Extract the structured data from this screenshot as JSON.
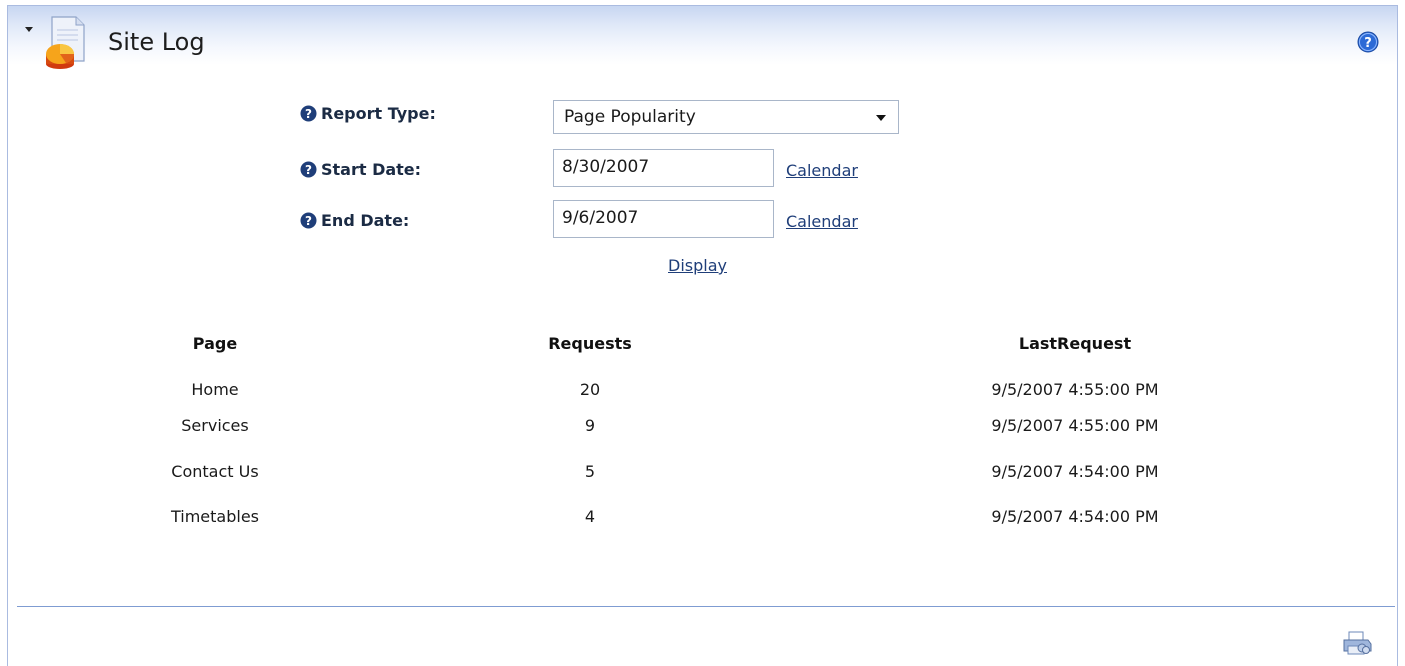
{
  "header": {
    "title": "Site Log",
    "collapse_icon": "collapse-arrow-icon",
    "module_icon": "site-log-icon",
    "help_icon": "help-icon"
  },
  "form": {
    "report_type": {
      "label": "Report Type:",
      "value": "Page Popularity"
    },
    "start_date": {
      "label": "Start Date:",
      "value": "8/30/2007",
      "calendar_link": "Calendar"
    },
    "end_date": {
      "label": "End Date:",
      "value": "9/6/2007",
      "calendar_link": "Calendar"
    },
    "display_link": "Display"
  },
  "table": {
    "headers": {
      "page": "Page",
      "requests": "Requests",
      "last_request": "LastRequest"
    },
    "rows": [
      {
        "page": "Home",
        "requests": "20",
        "last_request": "9/5/2007 4:55:00 PM"
      },
      {
        "page": "Services",
        "requests": "9",
        "last_request": "9/5/2007 4:55:00 PM"
      },
      {
        "page": "Contact Us",
        "requests": "5",
        "last_request": "9/5/2007 4:54:00 PM"
      },
      {
        "page": "Timetables",
        "requests": "4",
        "last_request": "9/5/2007 4:54:00 PM"
      }
    ]
  },
  "footer": {
    "print_icon": "print-icon"
  },
  "colors": {
    "border": "#aabbe0",
    "header_gradient_top": "#c7d6f1",
    "link": "#1f3e79",
    "label": "#1b2b44",
    "separator": "#7f9cd2"
  }
}
